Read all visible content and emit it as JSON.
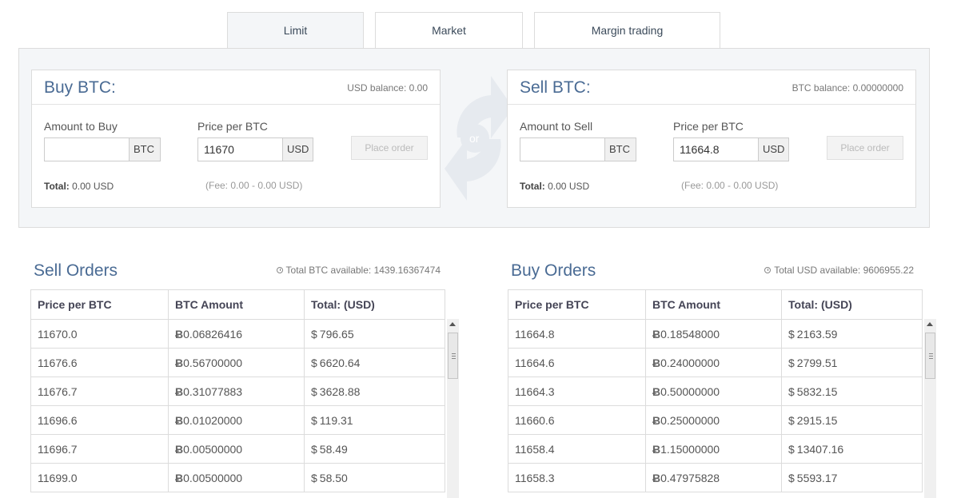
{
  "tabs": [
    {
      "label": "Limit"
    },
    {
      "label": "Market"
    },
    {
      "label": "Margin trading"
    }
  ],
  "buy": {
    "title": "Buy BTC:",
    "balance": "USD balance: 0.00",
    "amount_label": "Amount to Buy",
    "amount_value": "",
    "amount_unit": "BTC",
    "price_label": "Price per BTC",
    "price_value": "11670",
    "price_unit": "USD",
    "button": "Place order",
    "total_label": "Total:",
    "total_value": "0.00 USD",
    "fee": "(Fee: 0.00 - 0.00 USD)"
  },
  "swap_label": "or",
  "sell": {
    "title": "Sell BTC:",
    "balance": "BTC balance: 0.00000000",
    "amount_label": "Amount to Sell",
    "amount_value": "",
    "amount_unit": "BTC",
    "price_label": "Price per BTC",
    "price_value": "11664.8",
    "price_unit": "USD",
    "button": "Place order",
    "total_label": "Total:",
    "total_value": "0.00 USD",
    "fee": "(Fee: 0.00 - 0.00 USD)"
  },
  "sell_orders": {
    "title": "Sell Orders",
    "available": "Total BTC available: 1439.16367474",
    "headers": [
      "Price per BTC",
      "BTC Amount",
      "Total: (USD)"
    ],
    "rows": [
      [
        "11670.0",
        "0.06826416",
        "796.65"
      ],
      [
        "11676.6",
        "0.56700000",
        "6620.64"
      ],
      [
        "11676.7",
        "0.31077883",
        "3628.88"
      ],
      [
        "11696.6",
        "0.01020000",
        "119.31"
      ],
      [
        "11696.7",
        "0.00500000",
        "58.49"
      ],
      [
        "11699.0",
        "0.00500000",
        "58.50"
      ]
    ]
  },
  "buy_orders": {
    "title": "Buy Orders",
    "available": "Total USD available: 9606955.22",
    "headers": [
      "Price per BTC",
      "BTC Amount",
      "Total: (USD)"
    ],
    "rows": [
      [
        "11664.8",
        "0.18548000",
        "2163.59"
      ],
      [
        "11664.6",
        "0.24000000",
        "2799.51"
      ],
      [
        "11664.3",
        "0.50000000",
        "5832.15"
      ],
      [
        "11660.6",
        "0.25000000",
        "2915.15"
      ],
      [
        "11658.4",
        "1.15000000",
        "13407.16"
      ],
      [
        "11658.3",
        "0.47975828",
        "5593.17"
      ]
    ]
  },
  "symbols": {
    "btc": "Ƀ",
    "usd": "$"
  },
  "colors": {
    "accent": "#4a6b94",
    "panel_bg": "#f4f6f8",
    "border": "#dcdcdc"
  }
}
